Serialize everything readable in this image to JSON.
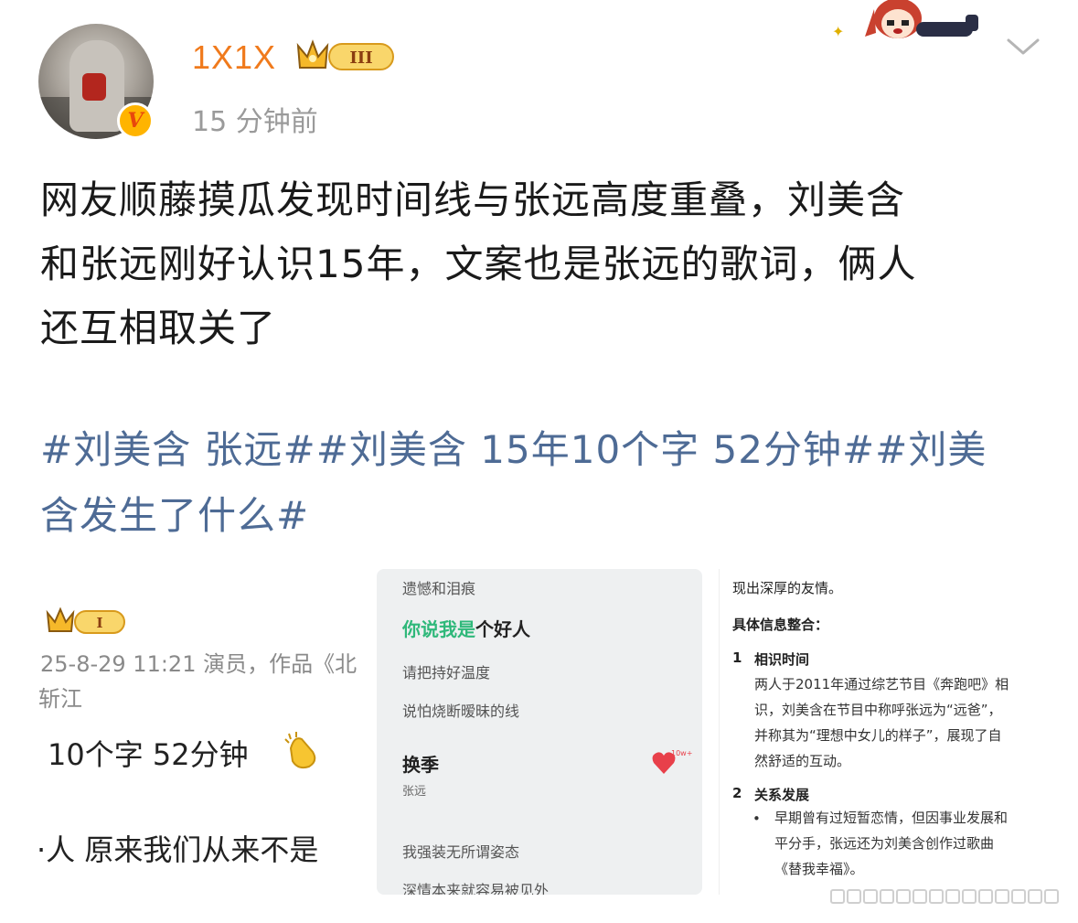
{
  "header": {
    "username": "1X1X",
    "level_label": "III",
    "verified_label": "V",
    "timestamp": "15 分钟前"
  },
  "post": {
    "lines": [
      "网友顺藤摸瓜发现时间线与张远高度重叠，刘美含",
      "和张远刚好认识15年，文案也是张远的歌词，俩人",
      "还互相取关了"
    ],
    "hashtag_lines": [
      "#刘美含 张远##刘美含 15年10个字 52分钟##刘美",
      "含发生了什么#"
    ]
  },
  "image1": {
    "level_label": "I",
    "meta": "25-8-29 11:21  演员，作品《北",
    "location": "斩江",
    "big_text": "10个字 52分钟",
    "bottom_text": "·人  原来我们从来不是"
  },
  "image2": {
    "line_top": "遗憾和泪痕",
    "highlight_green": "你说我是",
    "highlight_rest": "个好人",
    "line3": "请把持好温度",
    "line4": "说怕烧断暧昧的线",
    "song_title": "换季",
    "artist": "张远",
    "like_count": "10w+",
    "line5": "我强装无所谓姿态",
    "line6": "深情本来就容易被见外"
  },
  "image3": {
    "line0": "现出深厚的友情。",
    "heading": "具体信息整合：",
    "sec1_num": "1",
    "sec1_title": "相识时间",
    "sec1_body1": "两人于2011年通过综艺节目《奔跑吧》相",
    "sec1_body2": "识，刘美含在节目中称呼张远为“远爸”，",
    "sec1_body3": "并称其为“理想中女儿的样子”，展现了自",
    "sec1_body4": "然舒适的互动。",
    "sec2_num": "2",
    "sec2_title": "关系发展",
    "bullet": "•",
    "sec2_b1": "早期曾有过短暂恋情，但因事业发展和",
    "sec2_b2": "平分手，张远还为刘美含创作过歌曲",
    "sec2_b3": "《替我幸福》。"
  },
  "colors": {
    "username": "#f07a1c",
    "hashtag": "#4e6b95",
    "timestamp": "#9a9a9a",
    "highlight_green": "#2fb87a"
  }
}
